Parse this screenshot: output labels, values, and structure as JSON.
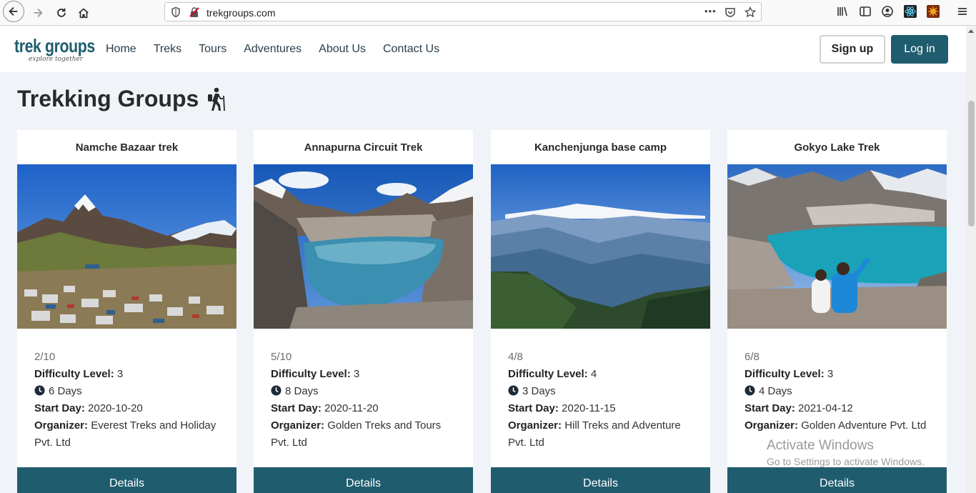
{
  "browser": {
    "url": "trekgroups.com",
    "menu_dots": "•••"
  },
  "header": {
    "logo_text": "trek groups",
    "logo_tagline": "explore together",
    "nav": [
      "Home",
      "Treks",
      "Tours",
      "Adventures",
      "About Us",
      "Contact Us"
    ],
    "signup_label": "Sign up",
    "login_label": "Log in"
  },
  "page": {
    "title": "Trekking Groups"
  },
  "cards": [
    {
      "title": "Namche Bazaar trek",
      "count": "2/10",
      "difficulty_label": "Difficulty Level:",
      "difficulty": "3",
      "duration": "6 Days",
      "start_label": "Start Day:",
      "start": "2020-10-20",
      "organizer_label": "Organizer:",
      "organizer": "Everest Treks and Holiday Pvt. Ltd",
      "details_label": "Details"
    },
    {
      "title": "Annapurna Circuit Trek",
      "count": "5/10",
      "difficulty_label": "Difficulty Level:",
      "difficulty": "3",
      "duration": "8 Days",
      "start_label": "Start Day:",
      "start": "2020-11-20",
      "organizer_label": "Organizer:",
      "organizer": "Golden Treks and Tours Pvt. Ltd",
      "details_label": "Details"
    },
    {
      "title": "Kanchenjunga base camp",
      "count": "4/8",
      "difficulty_label": "Difficulty Level:",
      "difficulty": "4",
      "duration": "3 Days",
      "start_label": "Start Day:",
      "start": "2020-11-15",
      "organizer_label": "Organizer:",
      "organizer": "Hill Treks and Adventure Pvt. Ltd",
      "details_label": "Details"
    },
    {
      "title": "Gokyo Lake Trek",
      "count": "6/8",
      "difficulty_label": "Difficulty Level:",
      "difficulty": "3",
      "duration": "4 Days",
      "start_label": "Start Day:",
      "start": "2021-04-12",
      "organizer_label": "Organizer:",
      "organizer": "Golden Adventure Pvt. Ltd",
      "details_label": "Details"
    }
  ],
  "watermark": {
    "title": "Activate Windows",
    "subtitle": "Go to Settings to activate Windows."
  },
  "colors": {
    "brand": "#1f5d6e",
    "page_bg": "#f0f4f8"
  }
}
